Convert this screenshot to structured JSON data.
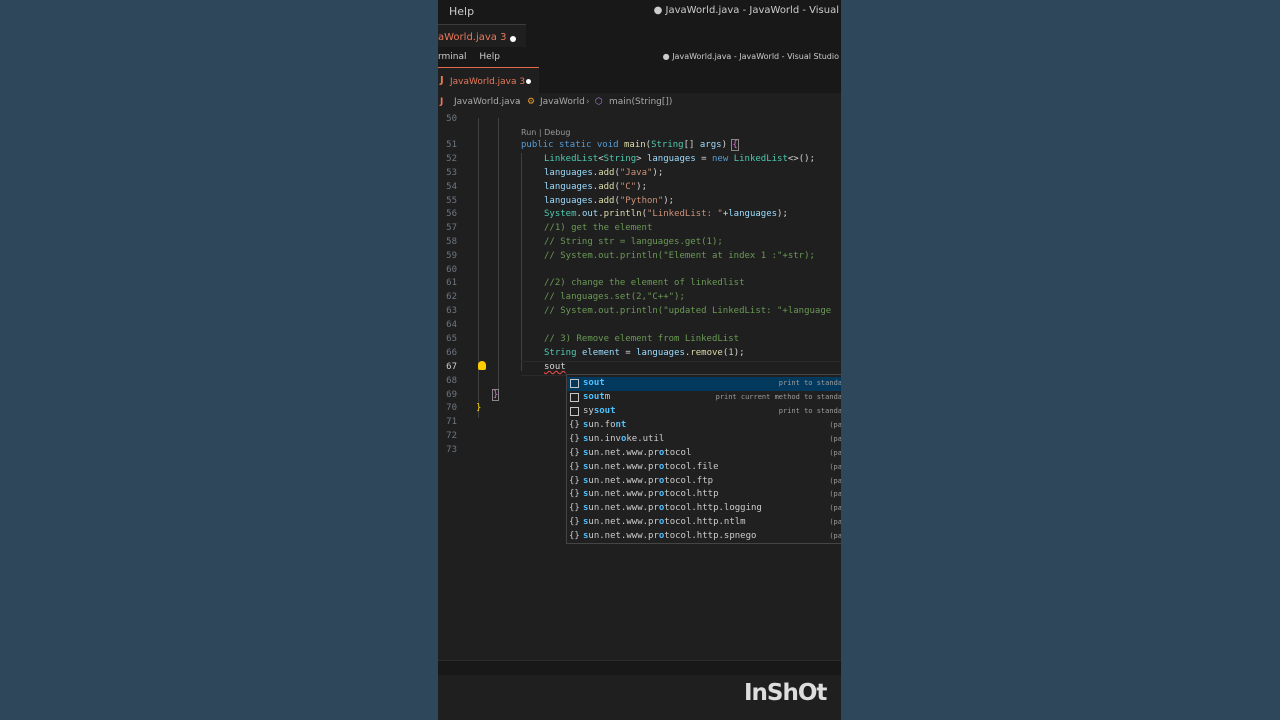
{
  "top_bar": {
    "menu": "Help",
    "title": "● JavaWorld.java - JavaWorld - Visual"
  },
  "top_tab": {
    "label": "aWorld.java 3"
  },
  "second_bar": {
    "menu_terminal": "rminal",
    "menu_help": "Help",
    "title": "● JavaWorld.java - JavaWorld - Visual Studio"
  },
  "editor_tab": {
    "icon": "J",
    "label": "JavaWorld.java 3"
  },
  "breadcrumb": {
    "file": "JavaWorld.java",
    "class": "JavaWorld",
    "method": "main(String[])"
  },
  "codelens": "Run | Debug",
  "line_numbers": [
    "50",
    "51",
    "52",
    "53",
    "54",
    "55",
    "56",
    "57",
    "58",
    "59",
    "60",
    "61",
    "62",
    "63",
    "64",
    "65",
    "66",
    "67",
    "68",
    "69",
    "70",
    "71",
    "72",
    "73"
  ],
  "suggestions": [
    {
      "match": "sout",
      "rest": "",
      "detail": "print to standa"
    },
    {
      "match": "sout",
      "rest": "m",
      "detail": "print current method to standa"
    },
    {
      "pre": "sy",
      "match": "sout",
      "rest": "",
      "detail": "print to standa"
    },
    {
      "pre": "",
      "match": "s",
      "rest": "un.fo",
      "match2": "nt",
      "rest2": "",
      "detail": "(pa"
    },
    {
      "pre": "",
      "match": "s",
      "rest": "un.inv",
      "match2": "o",
      "rest2": "ke.util",
      "detail": "(pa"
    },
    {
      "pre": "",
      "match": "s",
      "rest": "un.net.www.pr",
      "match2": "o",
      "rest2": "tocol",
      "detail": "(pa"
    },
    {
      "pre": "",
      "match": "s",
      "rest": "un.net.www.pr",
      "match2": "o",
      "rest2": "tocol.file",
      "detail": "(pa"
    },
    {
      "pre": "",
      "match": "s",
      "rest": "un.net.www.pr",
      "match2": "o",
      "rest2": "tocol.ftp",
      "detail": "(pa"
    },
    {
      "pre": "",
      "match": "s",
      "rest": "un.net.www.pr",
      "match2": "o",
      "rest2": "tocol.http",
      "detail": "(pa"
    },
    {
      "pre": "",
      "match": "s",
      "rest": "un.net.www.pr",
      "match2": "o",
      "rest2": "tocol.http.logging",
      "detail": "(pa"
    },
    {
      "pre": "",
      "match": "s",
      "rest": "un.net.www.pr",
      "match2": "o",
      "rest2": "tocol.http.ntlm",
      "detail": "(pa"
    },
    {
      "pre": "",
      "match": "s",
      "rest": "un.net.www.pr",
      "match2": "o",
      "rest2": "tocol.http.spnego",
      "detail": "(pa"
    }
  ],
  "watermark": "InShOt",
  "code": {
    "l51": {
      "a": "public",
      "b": "static",
      "c": "void",
      "d": "main",
      "e": "(",
      "f": "String",
      "g": "[]",
      "h": "args",
      "i": ")",
      "j": "{"
    },
    "l52": {
      "a": "LinkedList",
      "b": "<",
      "c": "String",
      "d": ">",
      "e": "languages",
      "f": "=",
      "g": "new",
      "h": "LinkedList",
      "i": "<>();"
    },
    "l53": {
      "a": "languages",
      "b": ".",
      "c": "add",
      "d": "(",
      "e": "\"Java\"",
      "f": ");"
    },
    "l54": {
      "a": "languages",
      "b": ".",
      "c": "add",
      "d": "(",
      "e": "\"C\"",
      "f": ");"
    },
    "l55": {
      "a": "languages",
      "b": ".",
      "c": "add",
      "d": "(",
      "e": "\"Python\"",
      "f": ");"
    },
    "l56": {
      "a": "System",
      "b": ".",
      "c": "out",
      "d": ".",
      "e": "println",
      "f": "(",
      "g": "\"LinkedList: \"",
      "h": "+",
      "i": "languages",
      "j": ");"
    },
    "l57": "//1) get the element",
    "l58": "// String str = languages.get(1);",
    "l59": "// System.out.println(\"Element at index 1 :\"+str);",
    "l61": "//2) change the element of linkedlist",
    "l62": "// languages.set(2,\"C++\");",
    "l63": "// System.out.println(\"updated LinkedList: \"+language",
    "l65": "// 3) Remove element from LinkedList",
    "l66": {
      "a": "String",
      "b": "element",
      "c": "=",
      "d": "languages",
      "e": ".",
      "f": "remove",
      "g": "(",
      "h": "1",
      "i": ");"
    },
    "l67": "sout",
    "l69": "}",
    "l70": "}"
  }
}
